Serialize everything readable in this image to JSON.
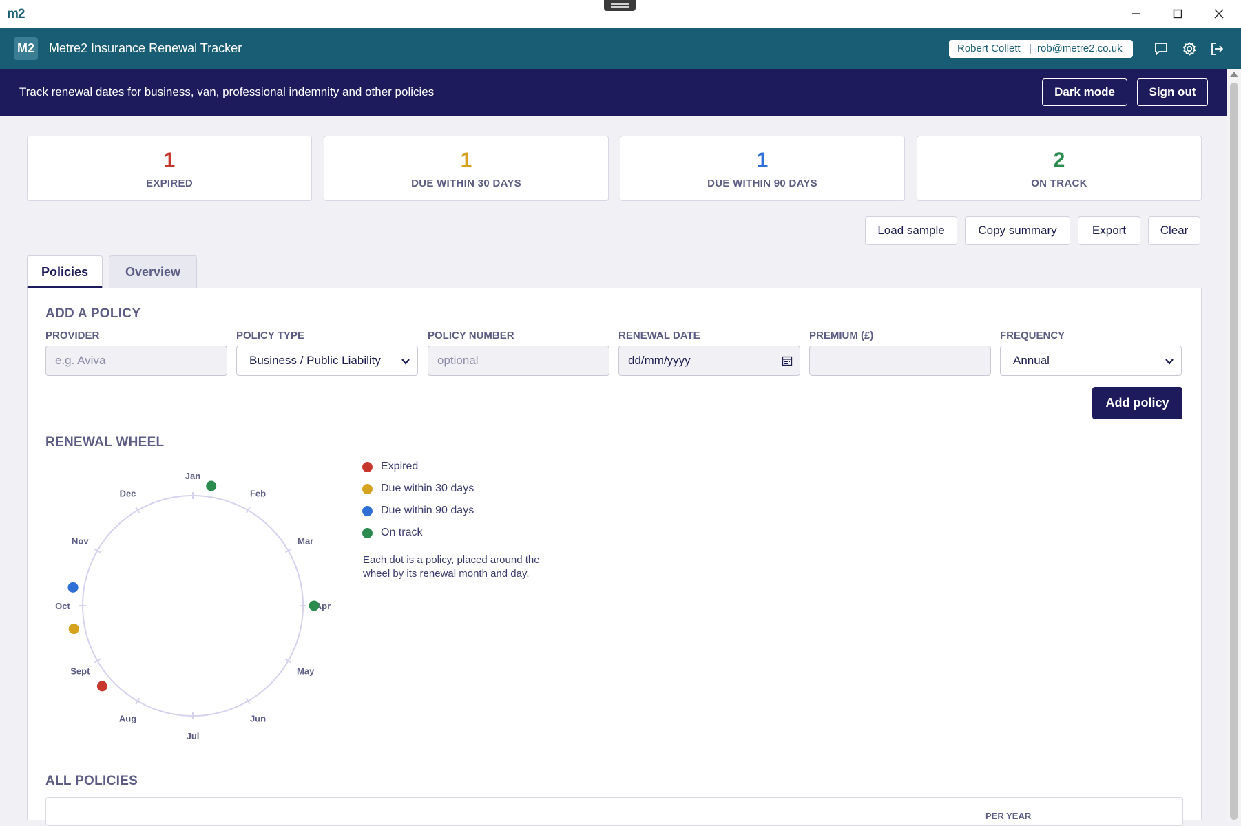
{
  "window": {
    "app_icon": "m2",
    "controls": [
      "minimize-icon",
      "maximize-icon",
      "close-icon"
    ]
  },
  "header": {
    "logo": "M2",
    "title": "Metre2 Insurance Renewal Tracker",
    "user_name": "Robert Collett",
    "user_email": "rob@metre2.co.uk",
    "icons": [
      "chat-icon",
      "gear-icon",
      "logout-icon"
    ]
  },
  "banner": {
    "text": "Track renewal dates for business, van, professional indemnity and other policies",
    "dark_mode_label": "Dark mode",
    "sign_out_label": "Sign out"
  },
  "stats": [
    {
      "value": "1",
      "label": "EXPIRED",
      "color": "#c8372d"
    },
    {
      "value": "1",
      "label": "DUE WITHIN 30 DAYS",
      "color": "#d6a21e"
    },
    {
      "value": "1",
      "label": "DUE WITHIN 90 DAYS",
      "color": "#2f6fd6"
    },
    {
      "value": "2",
      "label": "ON TRACK",
      "color": "#2b8a4e"
    }
  ],
  "actions": {
    "load_sample": "Load sample",
    "copy_summary": "Copy summary",
    "export": "Export",
    "clear": "Clear"
  },
  "tabs": {
    "policies": "Policies",
    "overview": "Overview",
    "active": "Policies"
  },
  "form": {
    "title": "ADD A POLICY",
    "provider_label": "PROVIDER",
    "provider_placeholder": "e.g. Aviva",
    "policy_type_label": "POLICY TYPE",
    "policy_type_value": "Business / Public Liability",
    "policy_number_label": "POLICY NUMBER",
    "policy_number_placeholder": "optional",
    "renewal_date_label": "RENEWAL DATE",
    "renewal_date_placeholder": "dd/mm/yyyy",
    "premium_label": "PREMIUM (£)",
    "premium_value": "",
    "frequency_label": "FREQUENCY",
    "frequency_value": "Annual",
    "add_label": "Add policy"
  },
  "wheel": {
    "title": "RENEWAL WHEEL",
    "months": [
      "Jan",
      "Feb",
      "Mar",
      "Apr",
      "May",
      "Jun",
      "Jul",
      "Aug",
      "Sept",
      "Oct",
      "Nov",
      "Dec"
    ],
    "dots": [
      {
        "month": 1,
        "day": 10,
        "status": "on-track"
      },
      {
        "month": 4,
        "day": 1,
        "status": "on-track"
      },
      {
        "month": 8,
        "day": 20,
        "status": "expired"
      },
      {
        "month": 9,
        "day": 20,
        "status": "due-30"
      },
      {
        "month": 10,
        "day": 10,
        "status": "due-90"
      }
    ],
    "legend": [
      {
        "label": "Expired",
        "color": "#c8372d"
      },
      {
        "label": "Due within 30 days",
        "color": "#d6a21e"
      },
      {
        "label": "Due within 90 days",
        "color": "#2f6fd6"
      },
      {
        "label": "On track",
        "color": "#2b8a4e"
      }
    ],
    "status_colors": {
      "expired": "#c8372d",
      "due-30": "#d6a21e",
      "due-90": "#2f6fd6",
      "on-track": "#2b8a4e"
    },
    "note": "Each dot is a policy, placed around the wheel by its renewal month and day."
  },
  "policies": {
    "title": "ALL POLICIES",
    "column_per_year": "PER YEAR"
  }
}
